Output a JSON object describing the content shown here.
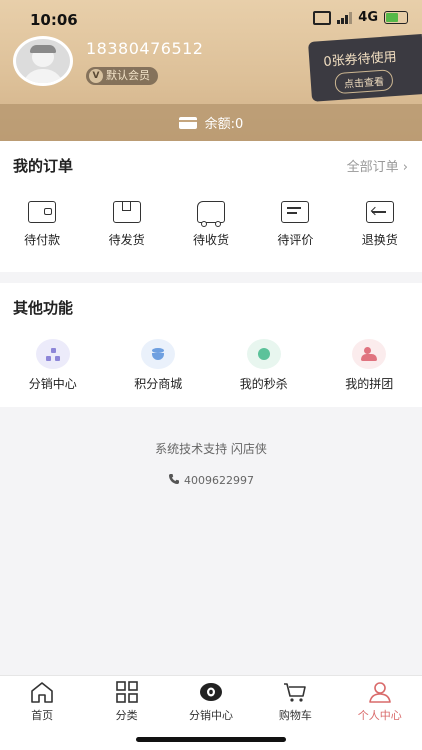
{
  "status_bar": {
    "time": "10:06",
    "network": "4G"
  },
  "profile": {
    "phone": "18380476512",
    "member_level": "默认会员",
    "coupon_text": "0张券待使用",
    "coupon_button": "点击查看",
    "balance": "余额:0"
  },
  "orders": {
    "title": "我的订单",
    "all_link": "全部订单 ›",
    "items": [
      {
        "label": "待付款",
        "icon": "wallet-icon"
      },
      {
        "label": "待发货",
        "icon": "package-icon"
      },
      {
        "label": "待收货",
        "icon": "truck-icon"
      },
      {
        "label": "待评价",
        "icon": "comment-icon"
      },
      {
        "label": "退换货",
        "icon": "return-icon"
      }
    ]
  },
  "functions": {
    "title": "其他功能",
    "items": [
      {
        "label": "分销中心",
        "icon": "distribution-icon",
        "color": "#ecebfa"
      },
      {
        "label": "积分商城",
        "icon": "points-icon",
        "color": "#eaf1fb"
      },
      {
        "label": "我的秒杀",
        "icon": "flash-sale-icon",
        "color": "#e8f6ef"
      },
      {
        "label": "我的拼团",
        "icon": "group-buy-icon",
        "color": "#fbeced"
      }
    ]
  },
  "footer": {
    "support": "系统技术支持 闪店侠",
    "phone": "4009622997"
  },
  "tabbar": {
    "items": [
      {
        "label": "首页",
        "icon": "home-icon"
      },
      {
        "label": "分类",
        "icon": "grid-icon"
      },
      {
        "label": "分销中心",
        "icon": "eye-icon"
      },
      {
        "label": "购物车",
        "icon": "cart-icon"
      },
      {
        "label": "个人中心",
        "icon": "user-icon"
      }
    ],
    "active": "个人中心",
    "accent_color": "#d96a6a"
  }
}
